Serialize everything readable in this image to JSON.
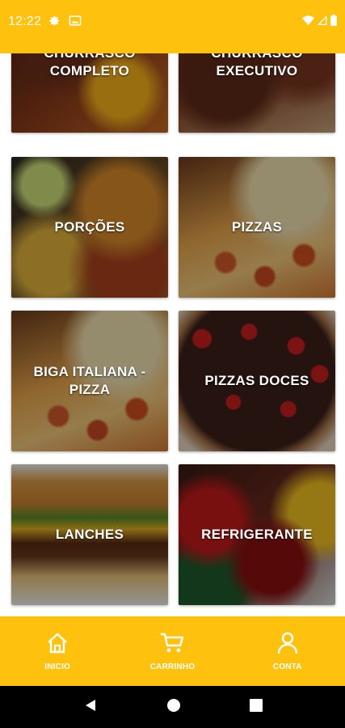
{
  "status_bar": {
    "time": "12:22",
    "background": "#fec10e",
    "left_icons": [
      "gear-icon",
      "photo-icon"
    ],
    "right_icons": [
      "wifi-icon",
      "signal-icon",
      "battery-icon"
    ]
  },
  "categories": [
    {
      "label": "CHURRASCO COMPLETO",
      "image": "churrasco-completo"
    },
    {
      "label": "CHURRASCO EXECUTIVO",
      "image": "churrasco-executivo"
    },
    {
      "label": "PORÇÕES",
      "image": "porcoes"
    },
    {
      "label": "PIZZAS",
      "image": "pizzas"
    },
    {
      "label": "BIGA ITALIANA - PIZZA",
      "image": "biga"
    },
    {
      "label": "PIZZAS DOCES",
      "image": "pizzas-doces"
    },
    {
      "label": "LANCHES",
      "image": "lanches"
    },
    {
      "label": "REFRIGERANTE",
      "image": "refrigerante"
    }
  ],
  "bottom_nav": {
    "background": "#fec10e",
    "items": [
      {
        "label": "INICIO",
        "icon": "home-icon"
      },
      {
        "label": "CARRINHO",
        "icon": "cart-icon"
      },
      {
        "label": "CONTA",
        "icon": "user-icon"
      }
    ]
  },
  "system_nav": {
    "buttons": [
      "back-icon",
      "home-circle-icon",
      "recents-icon"
    ]
  }
}
